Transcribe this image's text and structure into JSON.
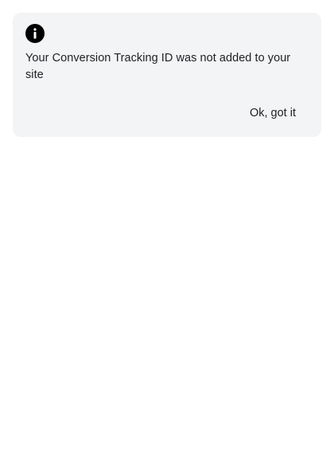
{
  "alert": {
    "icon": "info-icon",
    "message": "Your Conversion Tracking ID was not added to your site",
    "dismiss_label": "Ok, got it"
  },
  "colors": {
    "card_background": "#f3f4f6",
    "text": "#1f2024",
    "icon": "#000000"
  }
}
